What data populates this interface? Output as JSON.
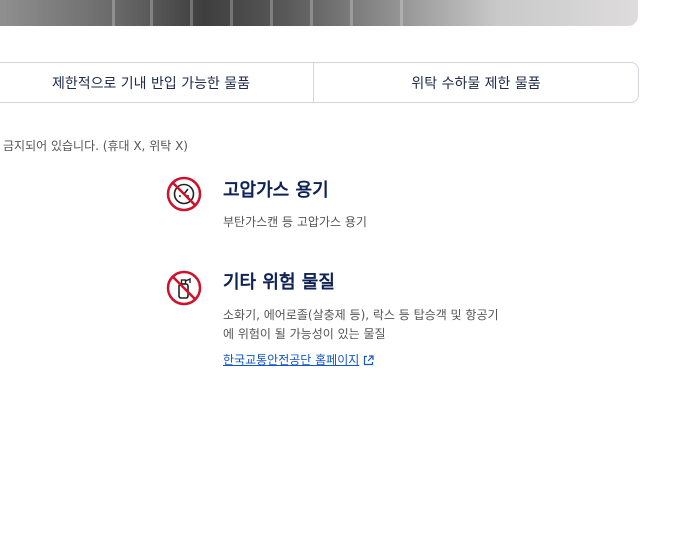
{
  "tabs": [
    {
      "label": "제한적으로 기내 반입 가능한 물품"
    },
    {
      "label": "위탁 수하물 제한 물품"
    }
  ],
  "notice": "금지되어 있습니다. (휴대 X, 위탁 X)",
  "items": [
    {
      "title": "고압가스 용기",
      "desc": [
        "부탄가스캔 등 고압가스 용기"
      ],
      "icon": "no-gas-cylinder-icon"
    },
    {
      "title": "기타 위험 물질",
      "desc": [
        "소화기, 에어로졸(살충제 등), 락스 등 탑승객 및 항공기",
        "에 위험이 될 가능성이 있는 물질"
      ],
      "link": "한국교통안전공단 홈페이지",
      "icon": "no-fire-extinguisher-icon"
    }
  ],
  "colors": {
    "prohibited_red": "#d0112b",
    "title_navy": "#0f2256",
    "link_blue": "#1556c7"
  }
}
